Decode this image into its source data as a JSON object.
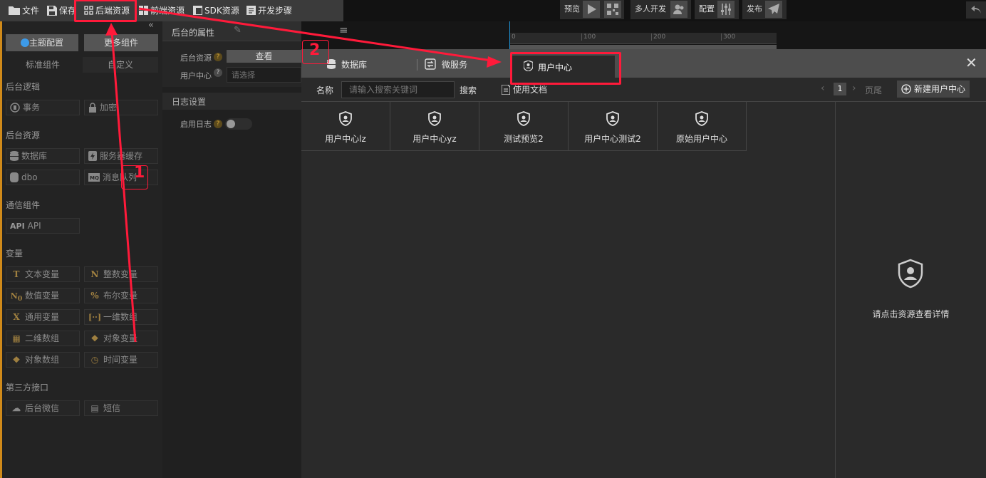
{
  "menu": {
    "file": "文件",
    "save": "保存",
    "backend": "后端资源",
    "frontend": "前端资源",
    "sdk": "SDK资源",
    "steps": "开发步骤"
  },
  "toolbar": {
    "preview": "预览",
    "multi": "多人开发",
    "config": "配置",
    "publish": "发布"
  },
  "ruler": {
    "ticks": [
      "0",
      "100",
      "200",
      "300"
    ]
  },
  "left": {
    "theme_btn": "主题配置",
    "more_btn": "更多组件",
    "tab_std": "标准组件",
    "tab_custom": "自定义",
    "cat_logic": "后台逻辑",
    "logic": [
      "事务",
      "加密"
    ],
    "cat_res": "后台资源",
    "res": [
      "数据库",
      "服务器缓存",
      "dbo",
      "消息队列"
    ],
    "cat_comm": "通信组件",
    "api": "API",
    "cat_var": "变量",
    "vars": [
      "文本变量",
      "整数变量",
      "数值变量",
      "布尔变量",
      "通用变量",
      "一维数组",
      "二维数组",
      "对象变量",
      "对象数组",
      "时间变量"
    ],
    "cat_third": "第三方接口",
    "third": [
      "后台微信",
      "短信"
    ]
  },
  "props": {
    "title": "后台的属性",
    "res_label": "后台资源",
    "view_btn": "查看",
    "uc_label": "用户中心",
    "uc_placeholder": "请选择",
    "log_title": "日志设置",
    "log_label": "启用日志"
  },
  "dialog": {
    "tabs": [
      "数据库",
      "微服务",
      "用户中心"
    ],
    "name_label": "名称",
    "search_placeholder": "请输入搜索关键词",
    "search_btn": "搜索",
    "docs": "使用文档",
    "page": "1",
    "last_page": "页尾",
    "new_btn": "新建用户中心",
    "cards": [
      "用户中心lz",
      "用户中心yz",
      "测试预览2",
      "用户中心测试2",
      "原始用户中心"
    ],
    "detail_hint": "请点击资源查看详情"
  },
  "annotations": {
    "num1": "1",
    "num2": "2"
  },
  "colors": {
    "annotation": "#ff1a3a",
    "accent": "#3d9be9",
    "var_icon": "#a08040"
  }
}
